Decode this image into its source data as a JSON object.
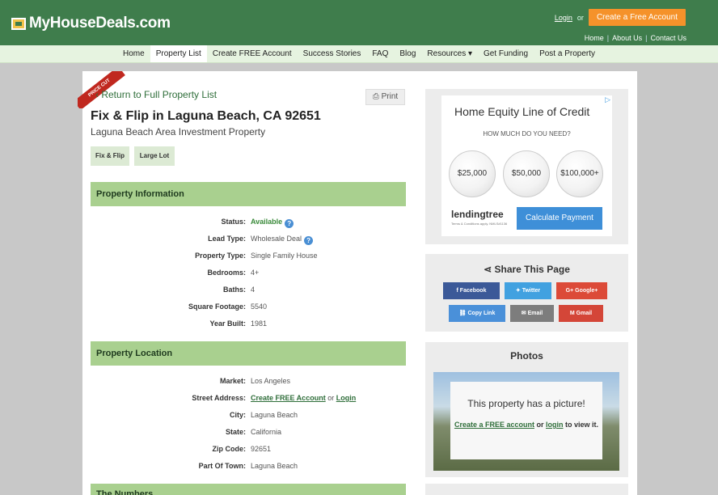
{
  "header": {
    "logo_text": "MyHouseDeals.com",
    "login_label": "Login",
    "or_text": "or",
    "create_account_label": "Create a Free Account",
    "links": [
      "Home",
      "About Us",
      "Contact Us"
    ]
  },
  "nav": {
    "items": [
      "Home",
      "Property List",
      "Create FREE Account",
      "Success Stories",
      "FAQ",
      "Blog",
      "Resources ▾",
      "Get Funding",
      "Post a Property"
    ],
    "active": "Property List"
  },
  "listing": {
    "ribbon": "PRICE CUT",
    "back_link": "Return to Full Property List",
    "print_label": "Print",
    "title": "Fix & Flip in Laguna Beach, CA 92651",
    "subtitle": "Laguna Beach Area Investment Property",
    "tags": [
      "Fix & Flip",
      "Large Lot"
    ]
  },
  "property_info": {
    "heading": "Property Information",
    "rows": [
      {
        "label": "Status:",
        "value": "Available"
      },
      {
        "label": "Lead Type:",
        "value": "Wholesale Deal"
      },
      {
        "label": "Property Type:",
        "value": "Single Family House"
      },
      {
        "label": "Bedrooms:",
        "value": "4+"
      },
      {
        "label": "Baths:",
        "value": "4"
      },
      {
        "label": "Square Footage:",
        "value": "5540"
      },
      {
        "label": "Year Built:",
        "value": "1981"
      }
    ]
  },
  "property_location": {
    "heading": "Property Location",
    "market_label": "Market:",
    "market": "Los Angeles",
    "street_label": "Street Address:",
    "street_link1": "Create FREE Account",
    "street_or": "or",
    "street_link2": "Login",
    "city_label": "City:",
    "city": "Laguna Beach",
    "state_label": "State:",
    "state": "California",
    "zip_label": "Zip Code:",
    "zip": "92651",
    "part_label": "Part Of Town:",
    "part": "Laguna Beach"
  },
  "next_section": {
    "heading": "The Numbers"
  },
  "ad": {
    "title": "Home Equity Line of Credit",
    "question": "HOW MUCH DO YOU NEED?",
    "amounts": [
      "$25,000",
      "$50,000",
      "$100,000+"
    ],
    "brand": "lendingtree",
    "brand_small": "Terms & Conditions apply. NMLS#1136",
    "cta": "Calculate Payment"
  },
  "share": {
    "title": "Share This Page",
    "buttons": [
      "Facebook",
      "Twitter",
      "Google+",
      "Copy Link",
      "Email",
      "Gmail"
    ]
  },
  "photos": {
    "title": "Photos",
    "message": "This property has a picture!",
    "link1": "Create a FREE account",
    "or": "or",
    "link2": "login",
    "suffix": "to view it."
  },
  "colors": {
    "brand_green": "#3f7d4c",
    "section_green": "#a9d08f",
    "cta_orange": "#f5922a",
    "facebook": "#3b5998",
    "twitter": "#41a1e0",
    "google": "#dc4a38",
    "copylink": "#4a90d9",
    "email": "#7d7d7d",
    "gmail": "#d44638"
  }
}
